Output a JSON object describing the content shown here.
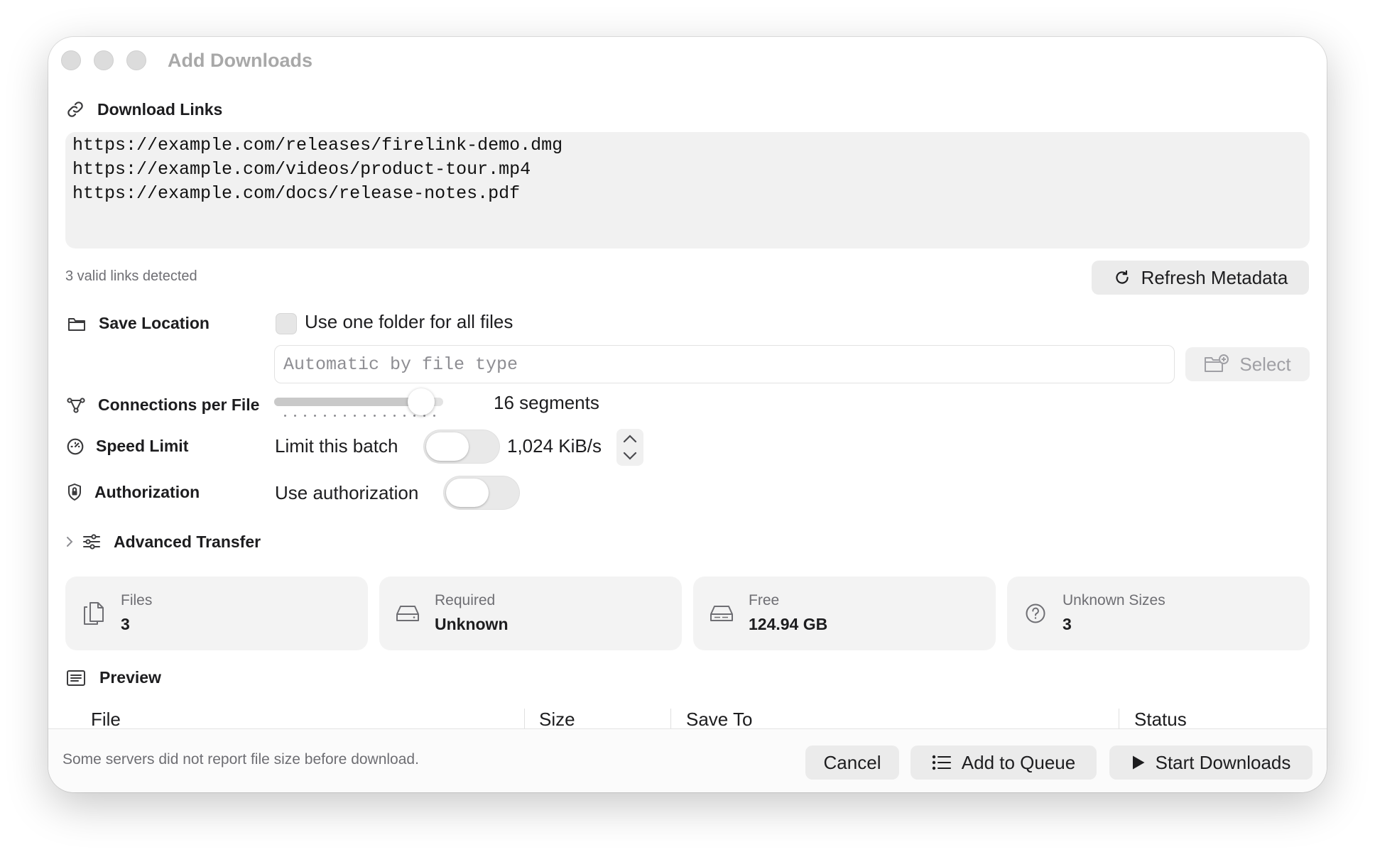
{
  "window": {
    "title": "Add Downloads"
  },
  "links": {
    "section_label": "Download Links",
    "lines": [
      "https://example.com/releases/firelink-demo.dmg",
      "https://example.com/videos/product-tour.mp4",
      "https://example.com/docs/release-notes.pdf"
    ],
    "status": "3 valid links detected",
    "refresh_label": "Refresh Metadata"
  },
  "save_location": {
    "label": "Save Location",
    "checkbox_label": "Use one folder for all files",
    "checkbox_checked": false,
    "path_placeholder": "Automatic by file type",
    "select_label": "Select"
  },
  "connections": {
    "label": "Connections per File",
    "value_label": "16 segments",
    "fraction": 0.94
  },
  "speed_limit": {
    "label": "Speed Limit",
    "toggle_label": "Limit this batch",
    "enabled": false,
    "value": "1,024 KiB/s"
  },
  "authorization": {
    "label": "Authorization",
    "toggle_label": "Use authorization",
    "enabled": false
  },
  "advanced": {
    "label": "Advanced Transfer"
  },
  "summary": [
    {
      "label": "Files",
      "value": "3",
      "icon": "files-icon"
    },
    {
      "label": "Required",
      "value": "Unknown",
      "icon": "drive-icon"
    },
    {
      "label": "Free",
      "value": "124.94 GB",
      "icon": "drive-icon"
    },
    {
      "label": "Unknown Sizes",
      "value": "3",
      "icon": "question-circle-icon"
    }
  ],
  "preview": {
    "label": "Preview",
    "columns": [
      "File",
      "Size",
      "Save To",
      "Status"
    ]
  },
  "footer": {
    "note": "Some servers did not report file size before download.",
    "cancel_label": "Cancel",
    "queue_label": "Add to Queue",
    "start_label": "Start Downloads"
  }
}
